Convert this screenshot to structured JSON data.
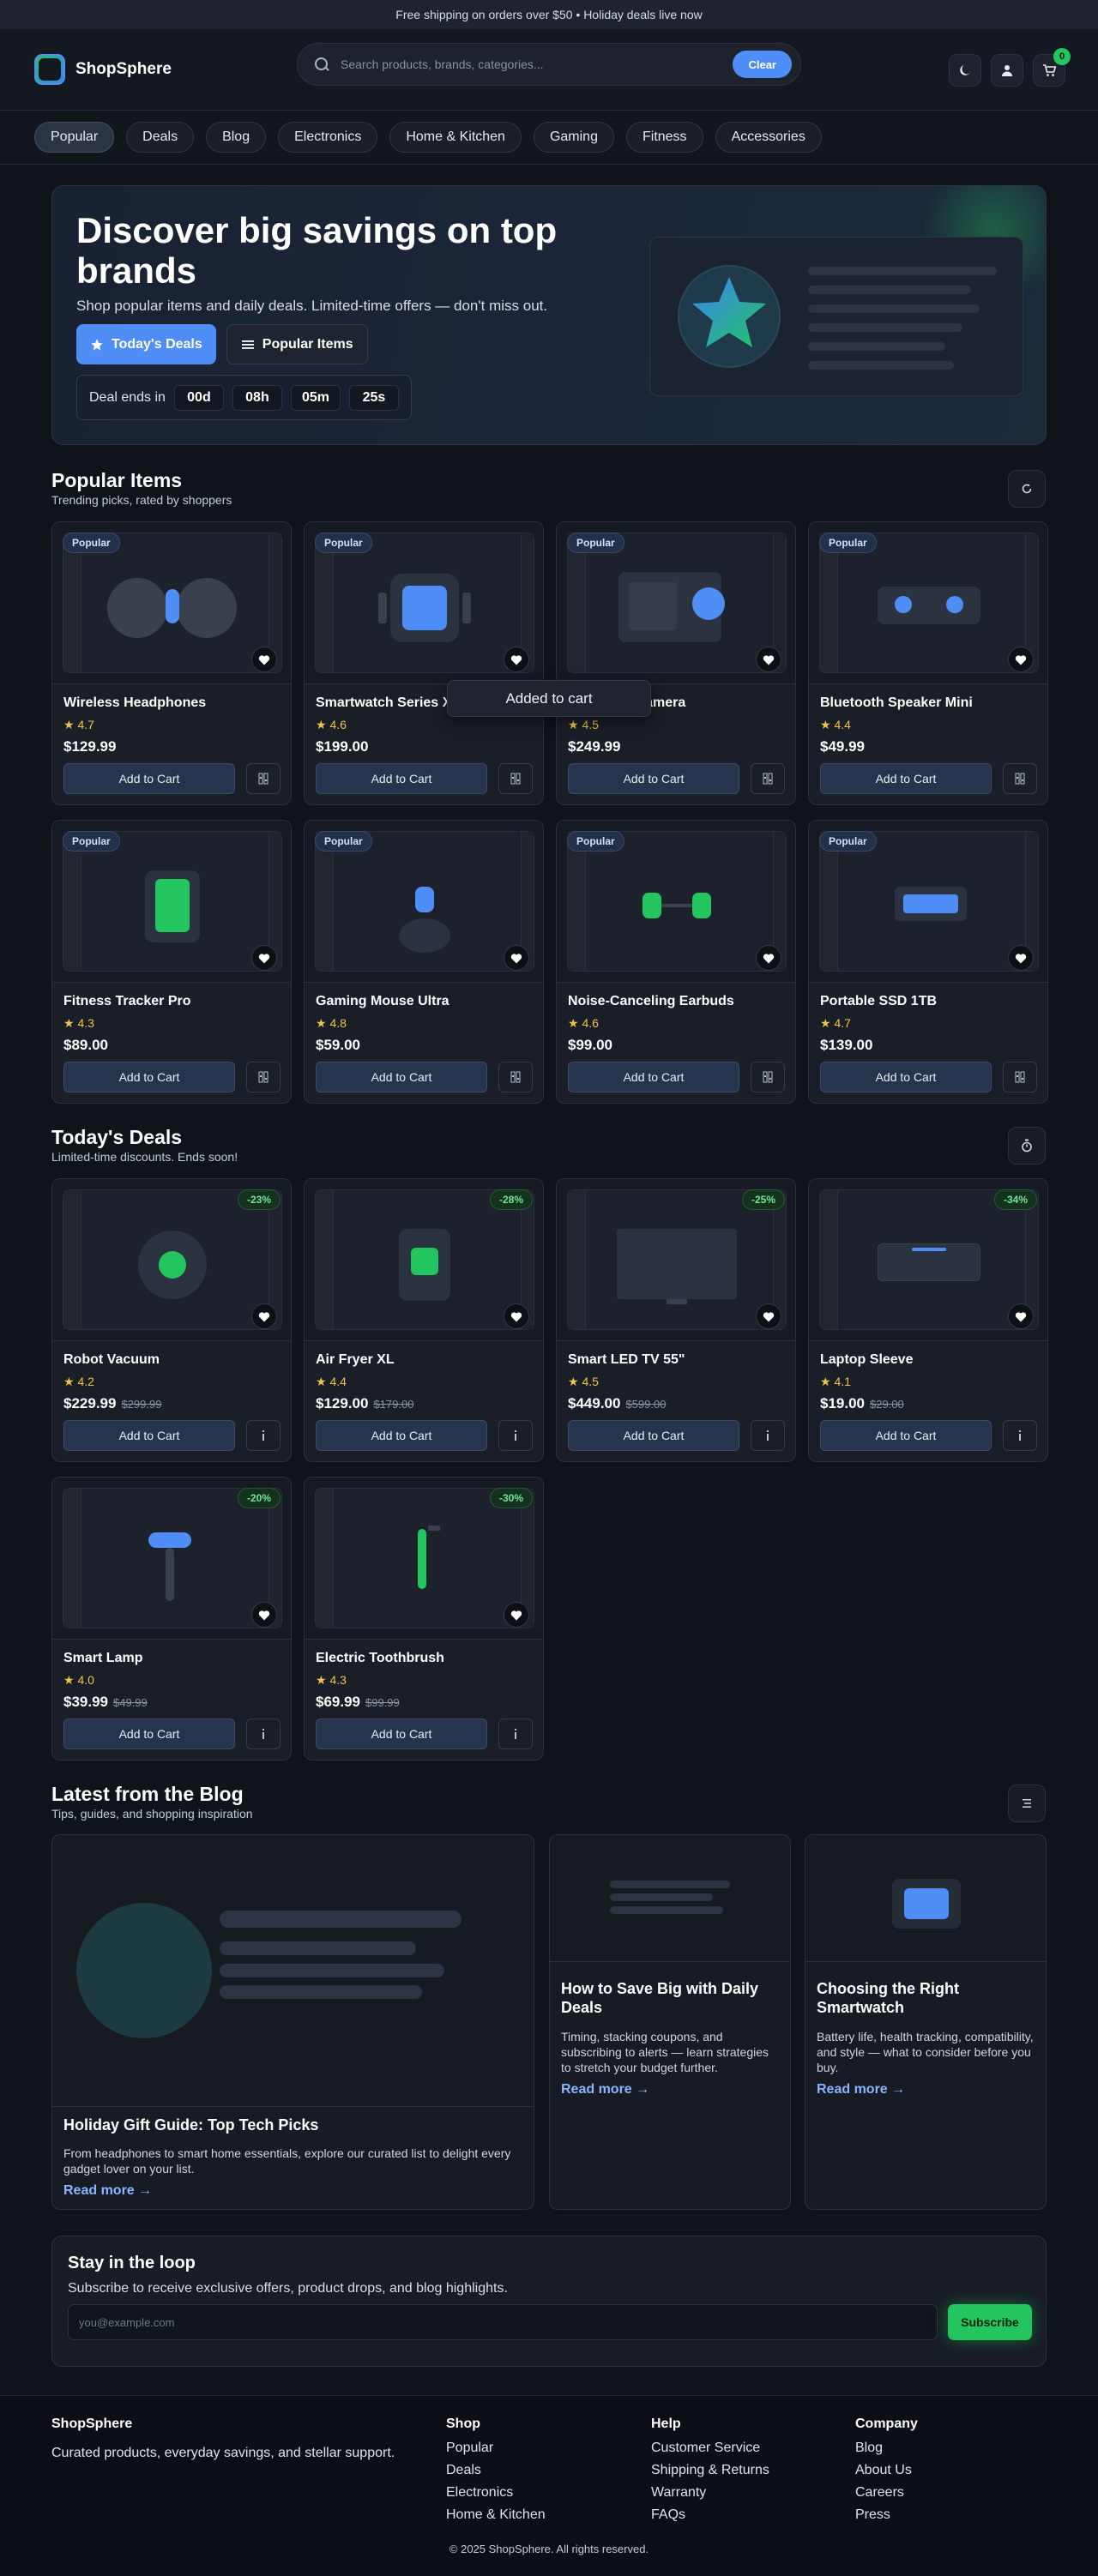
{
  "announcement": "Free shipping on orders over $50 • Holiday deals live now",
  "brand": {
    "name": "ShopSphere"
  },
  "search": {
    "placeholder": "Search products, brands, categories...",
    "clear_label": "Clear"
  },
  "header": {
    "cart_count": "0",
    "icons": [
      "moon-icon",
      "user-icon",
      "cart-icon"
    ]
  },
  "categories": [
    "Popular",
    "Deals",
    "Blog",
    "Electronics",
    "Home & Kitchen",
    "Gaming",
    "Fitness",
    "Accessories"
  ],
  "active_category": "Popular",
  "hero": {
    "title": "Discover big savings on top brands",
    "subtitle": "Shop popular items and daily deals. Limited-time offers — don't miss out.",
    "primary_label": "Today's Deals",
    "secondary_label": "Popular Items",
    "countdown_label": "Deal ends in",
    "countdown": [
      "00d",
      "08h",
      "05m",
      "25s"
    ]
  },
  "popular": {
    "title": "Popular Items",
    "subtitle": "Trending picks, rated by shoppers",
    "tag": "Popular",
    "add_label": "Add to Cart",
    "items": [
      {
        "name": "Wireless Headphones",
        "rating": "4.7",
        "price": "$129.99",
        "art": "headphones"
      },
      {
        "name": "Smartwatch Series X",
        "rating": "4.6",
        "price": "$199.00",
        "art": "watch"
      },
      {
        "name": "4K Action Camera",
        "rating": "4.5",
        "price": "$249.99",
        "art": "camera"
      },
      {
        "name": "Bluetooth Speaker Mini",
        "rating": "4.4",
        "price": "$49.99",
        "art": "speaker"
      },
      {
        "name": "Fitness Tracker Pro",
        "rating": "4.3",
        "price": "$89.00",
        "art": "tracker"
      },
      {
        "name": "Gaming Mouse Ultra",
        "rating": "4.8",
        "price": "$59.00",
        "art": "mouse"
      },
      {
        "name": "Noise-Canceling Earbuds",
        "rating": "4.6",
        "price": "$99.00",
        "art": "earbuds"
      },
      {
        "name": "Portable SSD 1TB",
        "rating": "4.7",
        "price": "$139.00",
        "art": "ssd"
      }
    ]
  },
  "toast": "Added to cart",
  "deals": {
    "title": "Today's Deals",
    "subtitle": "Limited-time discounts. Ends soon!",
    "add_label": "Add to Cart",
    "items": [
      {
        "name": "Robot Vacuum",
        "rating": "4.2",
        "price": "$229.99",
        "old": "$299.99",
        "discount": "-23%",
        "art": "vacuum"
      },
      {
        "name": "Air Fryer XL",
        "rating": "4.4",
        "price": "$129.00",
        "old": "$179.00",
        "discount": "-28%",
        "art": "fryer"
      },
      {
        "name": "Smart LED TV 55\"",
        "rating": "4.5",
        "price": "$449.00",
        "old": "$599.00",
        "discount": "-25%",
        "art": "tv"
      },
      {
        "name": "Laptop Sleeve",
        "rating": "4.1",
        "price": "$19.00",
        "old": "$29.00",
        "discount": "-34%",
        "art": "sleeve"
      },
      {
        "name": "Smart Lamp",
        "rating": "4.0",
        "price": "$39.99",
        "old": "$49.99",
        "discount": "-20%",
        "art": "lamp"
      },
      {
        "name": "Electric Toothbrush",
        "rating": "4.3",
        "price": "$69.99",
        "old": "$99.99",
        "discount": "-30%",
        "art": "toothbrush"
      }
    ]
  },
  "blog": {
    "title": "Latest from the Blog",
    "subtitle": "Tips, guides, and shopping inspiration",
    "read_more": "Read more →",
    "posts": [
      {
        "title": "Holiday Gift Guide: Top Tech Picks",
        "excerpt": "From headphones to smart home essentials, explore our curated list to delight every gadget lover on your list."
      },
      {
        "title": "How to Save Big with Daily Deals",
        "excerpt": "Timing, stacking coupons, and subscribing to alerts — learn strategies to stretch your budget further."
      },
      {
        "title": "Choosing the Right Smartwatch",
        "excerpt": "Battery life, health tracking, compatibility, and style — what to consider before you buy."
      }
    ]
  },
  "newsletter": {
    "title": "Stay in the loop",
    "subtitle": "Subscribe to receive exclusive offers, product drops, and blog highlights.",
    "placeholder": "you@example.com",
    "button": "Subscribe"
  },
  "footer": {
    "brand": "ShopSphere",
    "tagline": "Curated products, everyday savings, and stellar support.",
    "columns": [
      {
        "title": "Shop",
        "links": [
          "Popular",
          "Deals",
          "Electronics",
          "Home & Kitchen"
        ]
      },
      {
        "title": "Help",
        "links": [
          "Customer Service",
          "Shipping & Returns",
          "Warranty",
          "FAQs"
        ]
      },
      {
        "title": "Company",
        "links": [
          "Blog",
          "About Us",
          "Careers",
          "Press"
        ]
      }
    ],
    "copyright": "© 2025 ShopSphere. All rights reserved."
  },
  "colors": {
    "accent": "#4f8ef7",
    "success": "#22c55e",
    "star": "#f4c24b",
    "background": "#0f131a"
  }
}
